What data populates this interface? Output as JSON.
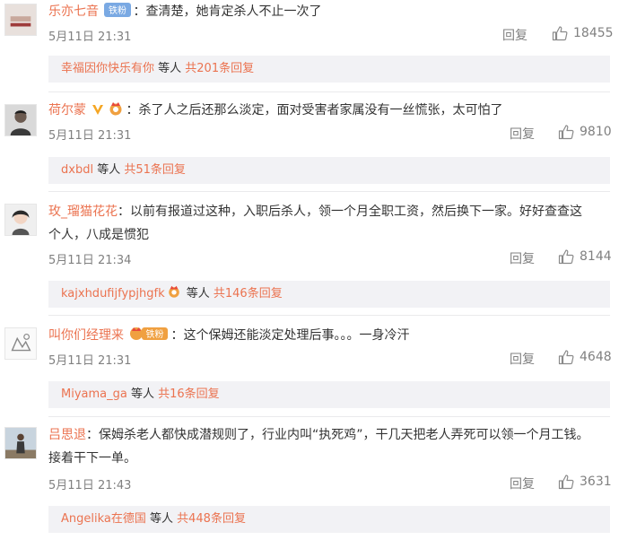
{
  "comments": [
    {
      "username": "乐亦七音",
      "badge": "铁粉",
      "text": "：查清楚，她肯定杀人不止一次了",
      "time": "5月11日 21:31",
      "reply": "回复",
      "likes": "18455",
      "sub_user": "幸福因你快乐有你",
      "sub_mid": " 等人 ",
      "sub_count": "共201条回复"
    },
    {
      "username": "荷尔蒙",
      "text": "：杀了人之后还那么淡定，面对受害者家属没有一丝慌张，太可怕了",
      "time": "5月11日 21:31",
      "reply": "回复",
      "likes": "9810",
      "sub_user": "dxbdl",
      "sub_mid": " 等人 ",
      "sub_count": "共51条回复"
    },
    {
      "username": "玫_瑠猫花花",
      "text_line1": "：以前有报道过这种，入职后杀人，领一个月全职工资，然后换下一家。好好查查这",
      "text_line2": "个人，八成是惯犯",
      "time": "5月11日 21:34",
      "reply": "回复",
      "likes": "8144",
      "sub_user": "kajxhdufijfypjhgfk",
      "sub_mid": " 等人 ",
      "sub_count": "共146条回复"
    },
    {
      "username": "叫你们经理来",
      "badge": "铁粉",
      "text": "：这个保姆还能淡定处理后事。。。一身冷汗",
      "time": "5月11日 21:31",
      "reply": "回复",
      "likes": "4648",
      "sub_user": "Miyama_ga",
      "sub_mid": " 等人 ",
      "sub_count": "共16条回复"
    },
    {
      "username": "吕思退",
      "text_line1": "：保姆杀老人都快成潜规则了，行业内叫“执死鸡”，干几天把老人弄死可以领一个月工钱。",
      "text_line2": "接着干下一单。",
      "time": "5月11日 21:43",
      "reply": "回复",
      "likes": "3631",
      "sub_user": "Angelika在德国",
      "sub_mid": " 等人 ",
      "sub_count": "共448条回复"
    }
  ],
  "colors": {
    "link": "#eb7350",
    "meta": "#808080",
    "sub_bg": "#f2f2f5",
    "vip_gold": "#f5a623",
    "badge_blue": "#7aa9e3",
    "badge_orange": "#f0a040"
  },
  "icons": {
    "like": "thumbs-up-icon",
    "vip": "v-verified-icon",
    "fan": "fan-crown-icon"
  }
}
